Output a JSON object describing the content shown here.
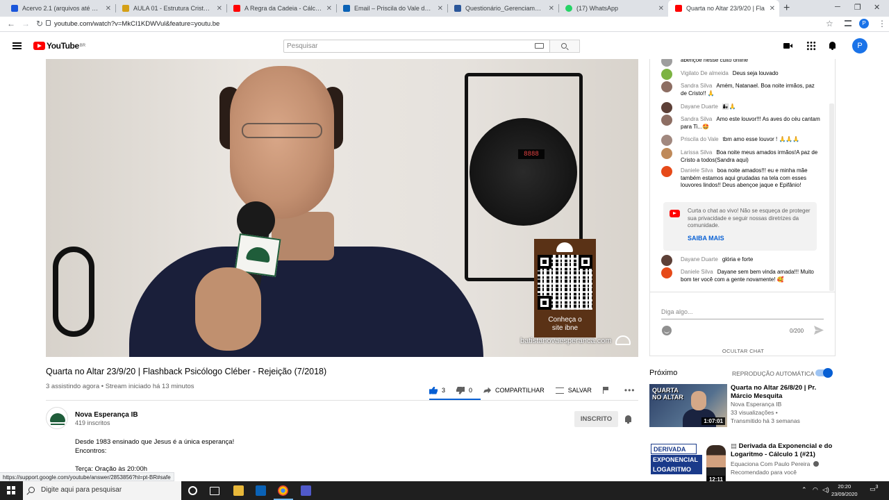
{
  "browser": {
    "tabs": [
      {
        "title": "Acervo 2.1 (arquivos até 2019.2)",
        "color": "#1a56db"
      },
      {
        "title": "AULA 01 - Estrutura Cristalina.pd",
        "color": "#d4a017"
      },
      {
        "title": "A Regra da Cadeia - Cálculo",
        "color": "#ff0000"
      },
      {
        "title": "Email – Priscila do Vale da Silva –",
        "color": "#0a62b6"
      },
      {
        "title": "Questionário_GerenciamentoRis",
        "color": "#2b579a"
      },
      {
        "title": "(17) WhatsApp",
        "color": "#25d366"
      },
      {
        "title": "Quarta no Altar 23/9/20 | Fla",
        "color": "#ff0000"
      }
    ],
    "new_tab": "+",
    "url": "youtube.com/watch?v=MkCI1KDWVul&feature=youtu.be",
    "status_url": "https://support.google.com/youtube/answer/2853856?hl=pt-BR#safe",
    "profile_initial": "P"
  },
  "youtube": {
    "logo_text": "YouTube",
    "logo_region": "BR",
    "search_placeholder": "Pesquisar",
    "avatar_initial": "P"
  },
  "video": {
    "lamp_display": "8888",
    "card_text_line1": "Conheça o",
    "card_text_line2": "site ibne",
    "site": "batistanovaesperanca.com",
    "title": "Quarta no Altar 23/9/20 | Flashback Psicólogo Cléber - Rejeição (7/2018)",
    "meta": "3 assistindo agora • Stream iniciado há 13 minutos",
    "likes": "3",
    "dislikes": "0",
    "share_label": "COMPARTILHAR",
    "save_label": "SALVAR"
  },
  "channel": {
    "name": "Nova Esperança IB",
    "subscribers": "419 inscritos",
    "subscribe_label": "INSCRITO",
    "description": [
      "Desde 1983 ensinado que Jesus é a única esperança!",
      "Encontros:",
      "",
      "Terça: Oração às 20:00h"
    ]
  },
  "chat": {
    "messages": [
      {
        "author": "",
        "text": "abençoe nesse culto online",
        "color": "#9e9e9e"
      },
      {
        "author": "Vigilato De almeida",
        "text": "Deus seja louvado",
        "color": "#7cb342"
      },
      {
        "author": "Sandra Silva",
        "text": "Amém, Natanael. Boa noite irmãos, paz de Cristo!! 🙏",
        "color": "#8d6e63"
      },
      {
        "author": "Dayane Duarte",
        "text": "👩‍👧🙏",
        "color": "#5d4037"
      },
      {
        "author": "Sandra Silva",
        "text": "Amo este louvor!!! As aves do céu cantam para Ti...🤩",
        "color": "#8d6e63"
      },
      {
        "author": "Priscila do Vale",
        "text": "tbm amo esse louvor ! 🙏🙏🙏",
        "color": "#a1887f"
      },
      {
        "author": "Larissa Silva",
        "text": "Boa noite meus amados irmãos!A paz de Cristo a todos(Sandra aqui)",
        "color": "#bf8a5a"
      },
      {
        "author": "Daniele Silva",
        "text": "boa noite amados!!! eu e minha mãe também estamos aqui grudadas na tela com esses louvores lindos!! Deus abençoe jaque e Epifânio!",
        "color": "#e64a19"
      },
      {
        "author": "Dayane Duarte",
        "text": "glória e forte",
        "color": "#5d4037"
      },
      {
        "author": "Daniele Silva",
        "text": "Dayane sem bem vinda amada!!! Muito bom ter você com a gente novamente! 🥰",
        "color": "#e64a19"
      }
    ],
    "notice_text": "Curta o chat ao vivo! Não se esqueça de proteger sua privacidade e seguir nossas diretrizes da comunidade.",
    "notice_link": "SAIBA MAIS",
    "input_placeholder": "Diga algo...",
    "counter": "0/200",
    "hide_label": "OCULTAR CHAT"
  },
  "next": {
    "label": "Próximo",
    "autoplay_label": "REPRODUÇÃO AUTOMÁTICA",
    "autoplay_on": true,
    "items": [
      {
        "title": "Quarta no Altar 26/8/20 | Pr. Márcio Mesquita",
        "channel": "Nova Esperança IB",
        "views": "33 visualizações •",
        "age": "Transmitido há 3 semanas",
        "duration": "1:07:01",
        "thumb_text1": "QUARTA",
        "thumb_text2": "NO ALTAR"
      },
      {
        "title": "Derivada da Exponencial e do Logaritmo - Cálculo 1 (#21)",
        "channel": "Equaciona Com Paulo Pereira",
        "views": "Recomendado para você",
        "duration": "12:11",
        "thumb_text1": "DERIVADA",
        "thumb_text2": "EXPONENCIAL",
        "thumb_text3": "LOGARITMO"
      }
    ]
  },
  "taskbar": {
    "search_placeholder": "Digite aqui para pesquisar",
    "time": "20:20",
    "date": "23/09/2020",
    "notifications": "3"
  }
}
